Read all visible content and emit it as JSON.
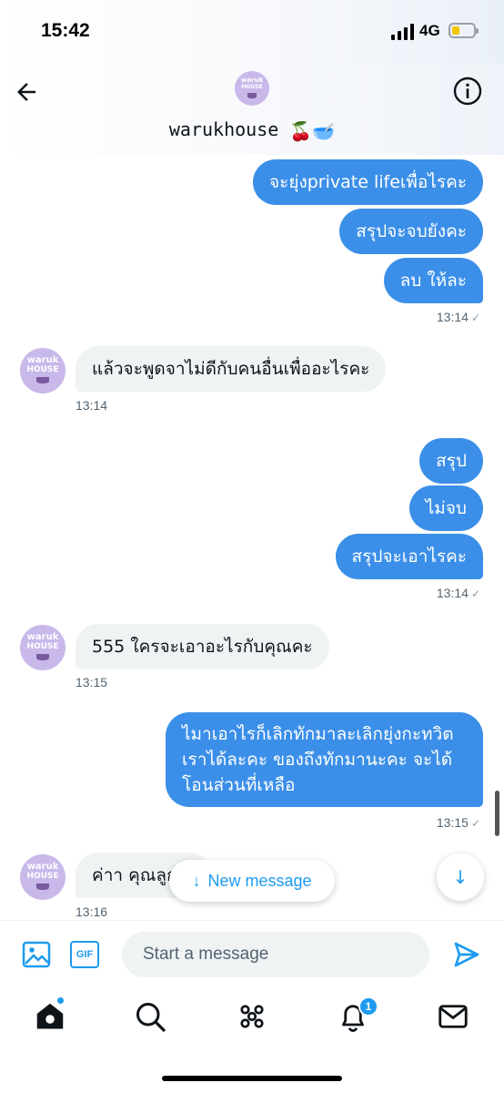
{
  "status_bar": {
    "time": "15:42",
    "network": "4G"
  },
  "header": {
    "handle": "warukhouse",
    "handle_emoji": "🍒🥣",
    "avatar_text_top": "waruk",
    "avatar_text_bottom": "HOUSE"
  },
  "messages": [
    {
      "dir": "out",
      "text": "จะยุ่งprivate lifeเพื่อไรคะ"
    },
    {
      "dir": "out",
      "text": "สรุปจะจบยังคะ"
    },
    {
      "dir": "out",
      "text": "ลบ ให้ละ",
      "time": "13:14"
    },
    {
      "dir": "in",
      "text": "แล้วจะพูดจาไม่ดีกับคนอื่นเพื่ออะไรคะ",
      "time": "13:14"
    },
    {
      "dir": "out",
      "text": "สรุป"
    },
    {
      "dir": "out",
      "text": "ไม่จบ"
    },
    {
      "dir": "out",
      "text": "สรุปจะเอาไรคะ",
      "time": "13:14"
    },
    {
      "dir": "in",
      "text": "555 ใครจะเอาอะไรกับคุณคะ",
      "time": "13:15"
    },
    {
      "dir": "out",
      "lines": [
        "ไมาเอาไรก็เลิกทักมาละเลิกยุ่งกะทวิต",
        "เราได้ละคะ ของถึงทักมานะคะ จะได้",
        "โอนส่วนที่เหลือ"
      ],
      "time": "13:15"
    },
    {
      "dir": "in",
      "text": "ค่าา คุณลูก",
      "time": "13:16"
    }
  ],
  "new_message_pill": {
    "arrow": "↓",
    "label": "New message"
  },
  "scroll_down_button": {
    "arrow": "↓"
  },
  "composer": {
    "placeholder": "Start a message",
    "gif_label": "GIF"
  },
  "tabbar": {
    "notifications_badge": "1"
  },
  "colors": {
    "accent": "#1d9bf0",
    "outgoing_bubble": "#3b8fe8",
    "incoming_bubble": "#eff3f4"
  }
}
